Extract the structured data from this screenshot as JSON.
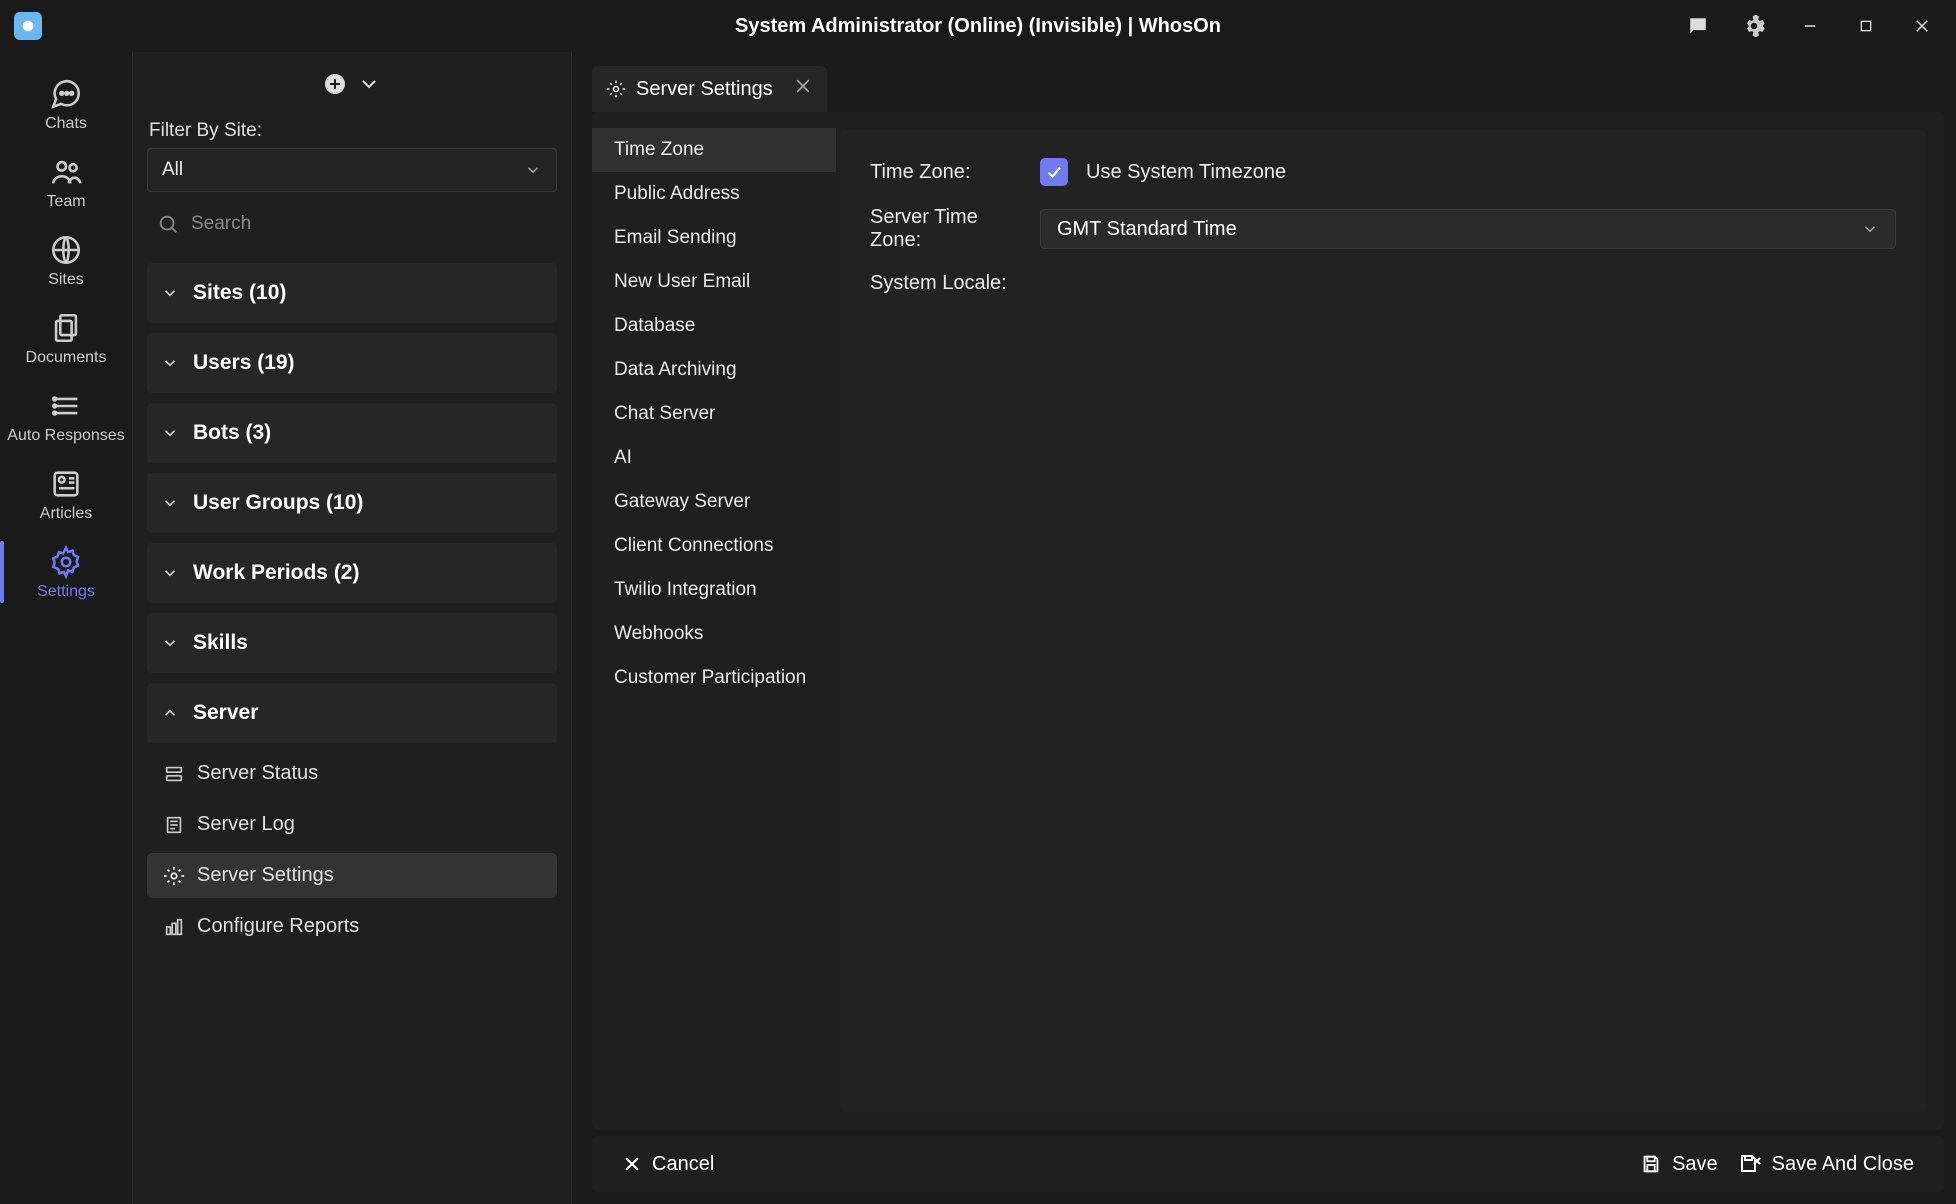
{
  "title": "System Administrator (Online) (Invisible) | WhosOn",
  "rail": [
    {
      "label": "Chats"
    },
    {
      "label": "Team"
    },
    {
      "label": "Sites"
    },
    {
      "label": "Documents"
    },
    {
      "label": "Auto Responses"
    },
    {
      "label": "Articles"
    },
    {
      "label": "Settings"
    }
  ],
  "sidebar": {
    "filter_label": "Filter By Site:",
    "filter_value": "All",
    "search_placeholder": "Search",
    "groups": [
      {
        "label": "Sites (10)"
      },
      {
        "label": "Users (19)"
      },
      {
        "label": "Bots (3)"
      },
      {
        "label": "User Groups (10)"
      },
      {
        "label": "Work Periods (2)"
      },
      {
        "label": "Skills"
      },
      {
        "label": "Server"
      }
    ],
    "server_items": [
      {
        "label": "Server Status"
      },
      {
        "label": "Server Log"
      },
      {
        "label": "Server Settings"
      },
      {
        "label": "Configure Reports"
      }
    ]
  },
  "tab": {
    "label": "Server Settings"
  },
  "settings_nav": [
    "Time Zone",
    "Public Address",
    "Email Sending",
    "New User Email",
    "Database",
    "Data Archiving",
    "Chat Server",
    "AI",
    "Gateway Server",
    "Client Connections",
    "Twilio Integration",
    "Webhooks",
    "Customer Participation"
  ],
  "form": {
    "time_zone_label": "Time Zone:",
    "use_system_label": "Use System Timezone",
    "server_tz_label": "Server Time Zone:",
    "server_tz_value": "GMT Standard Time",
    "system_locale_label": "System Locale:"
  },
  "footer": {
    "cancel": "Cancel",
    "save": "Save",
    "save_close": "Save And Close"
  }
}
